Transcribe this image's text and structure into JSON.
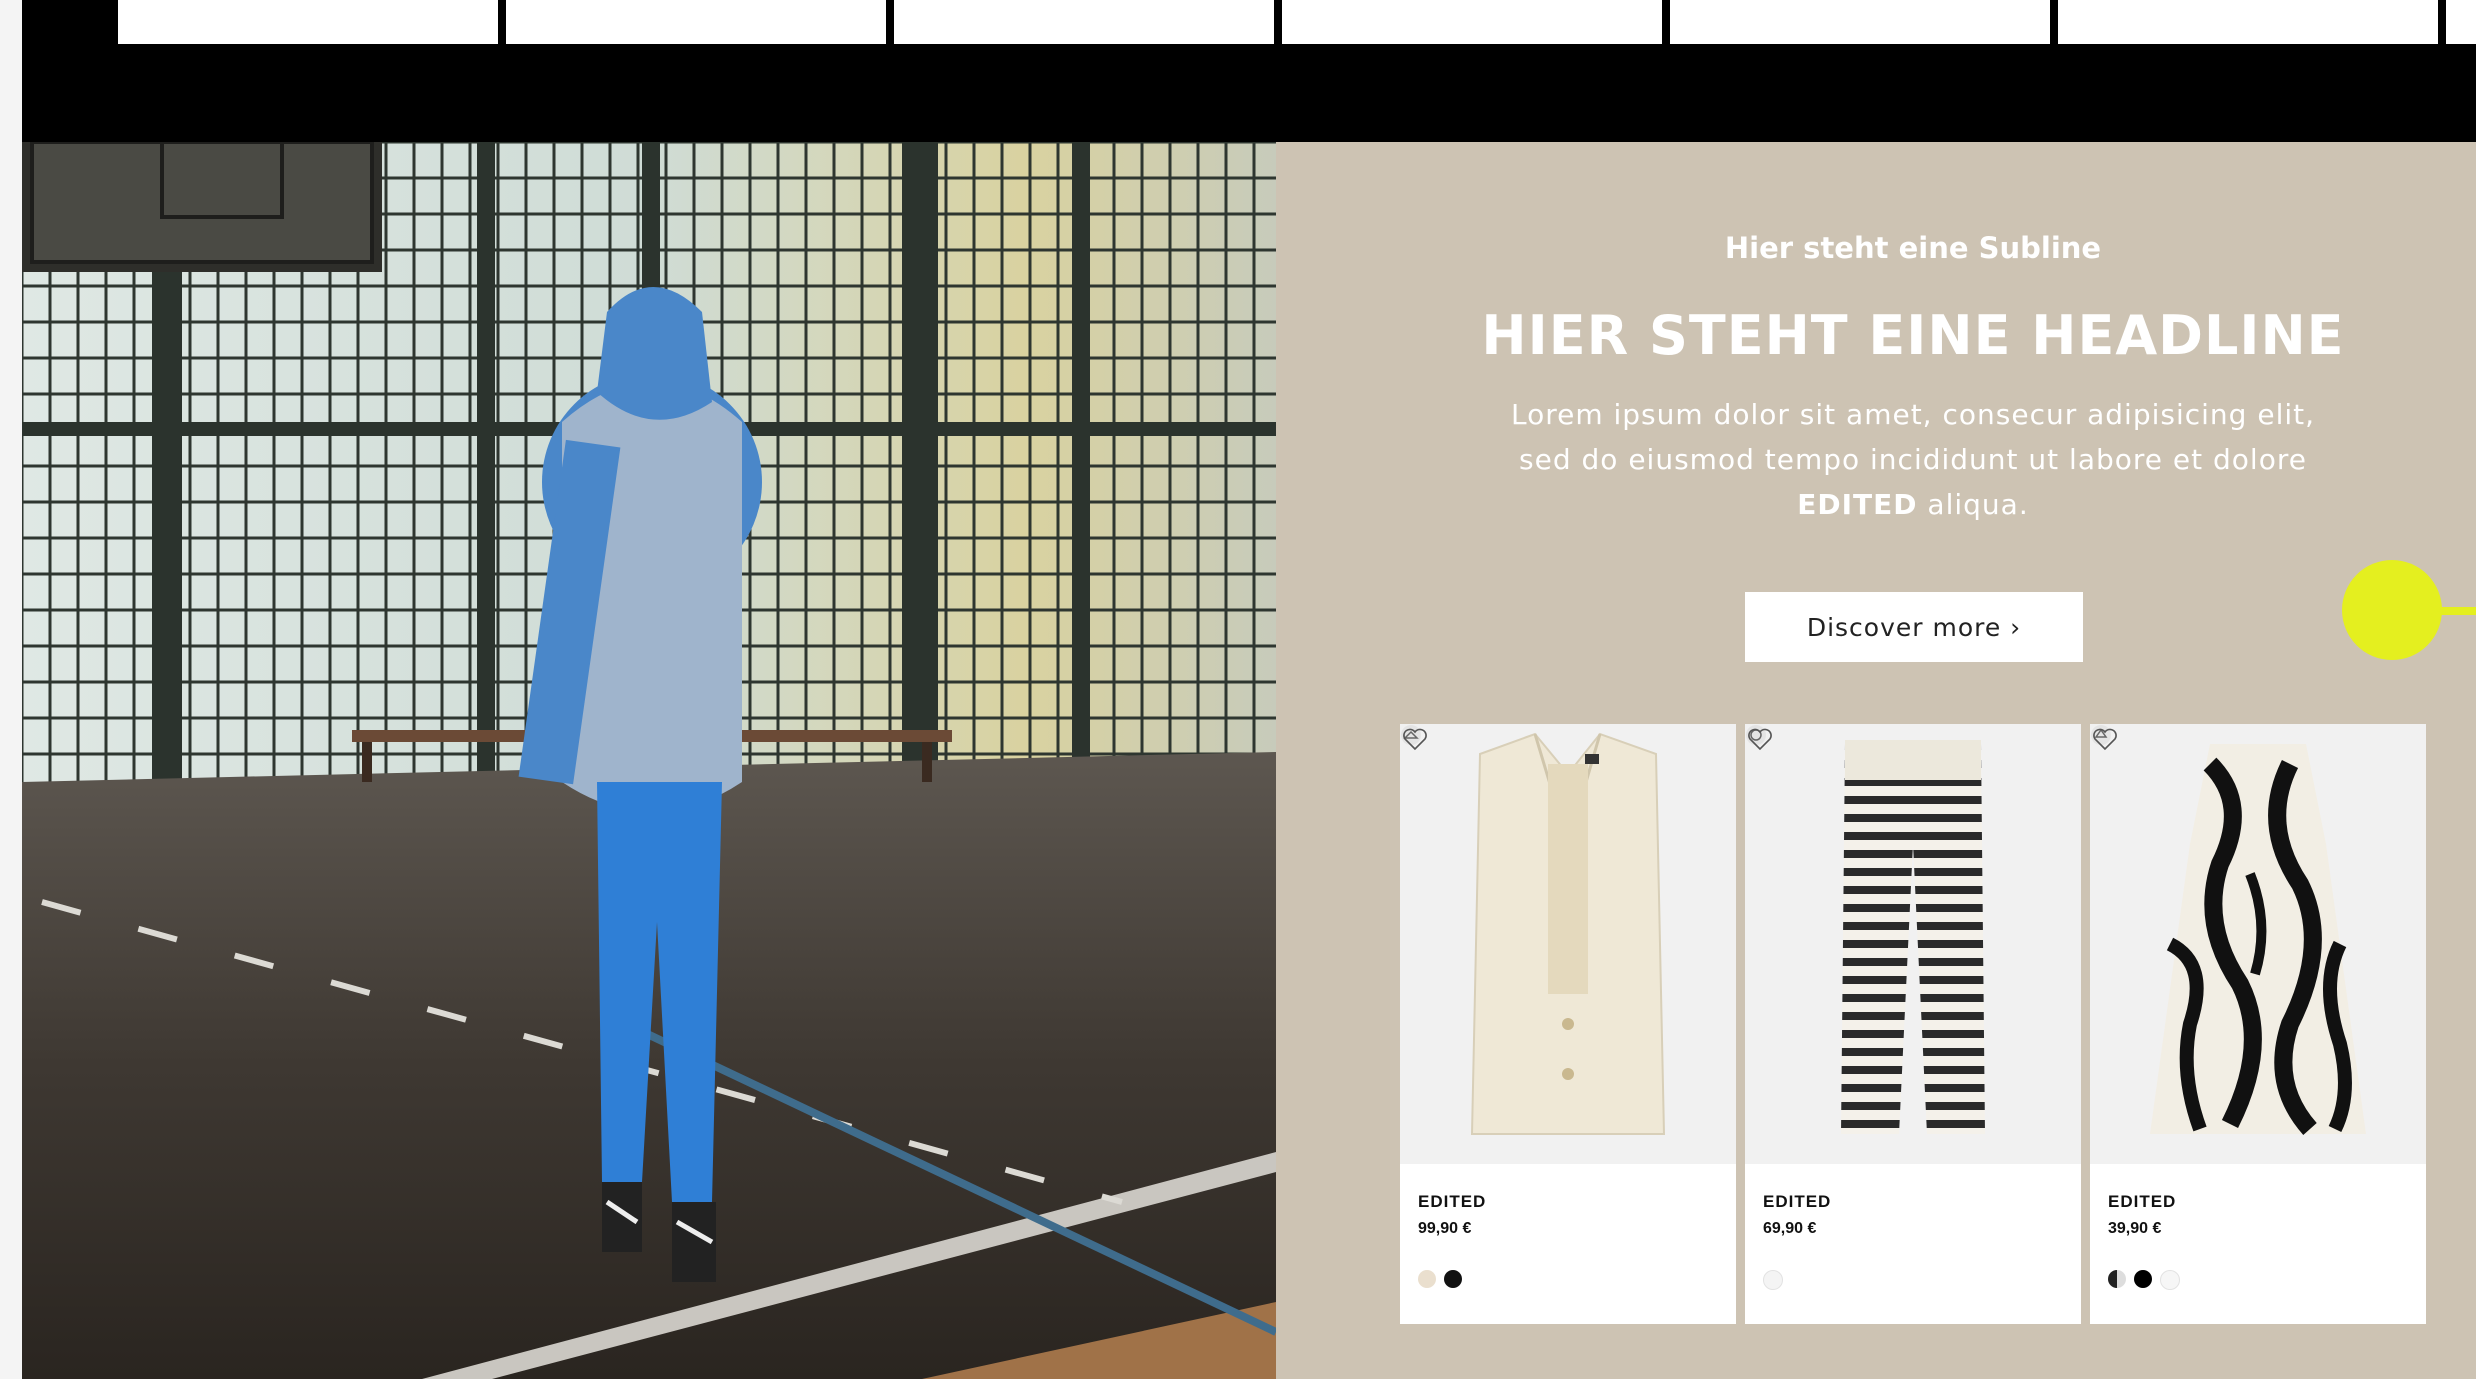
{
  "promo": {
    "subline": "Hier steht eine Subline",
    "headline": "HIER STEHT EINE HEADLINE",
    "body_line1": "Lorem ipsum dolor sit amet, consecur adipisicing elit,",
    "body_line2": "sed do eiusmod tempo incididunt ut labore et dolore",
    "body_bold": "EDITED",
    "body_end": " aliqua.",
    "cta_label": "Discover more ›"
  },
  "products": [
    {
      "brand": "EDITED",
      "price": "99,90 €",
      "icon": "hanger-icon",
      "swatches": [
        "#eadfce",
        "#111111"
      ]
    },
    {
      "brand": "EDITED",
      "price": "69,90 €",
      "icon": "circle-icon",
      "swatches": [
        "#f4f4f4"
      ]
    },
    {
      "brand": "EDITED",
      "price": "39,90 €",
      "icon": "recycle-icon",
      "swatches": [
        "#222222",
        "#000000",
        "#f6f6f6"
      ]
    }
  ],
  "colors": {
    "panel": "#cdc3b3",
    "top_bar": "#000000",
    "annotation": "#e4ef1f"
  }
}
